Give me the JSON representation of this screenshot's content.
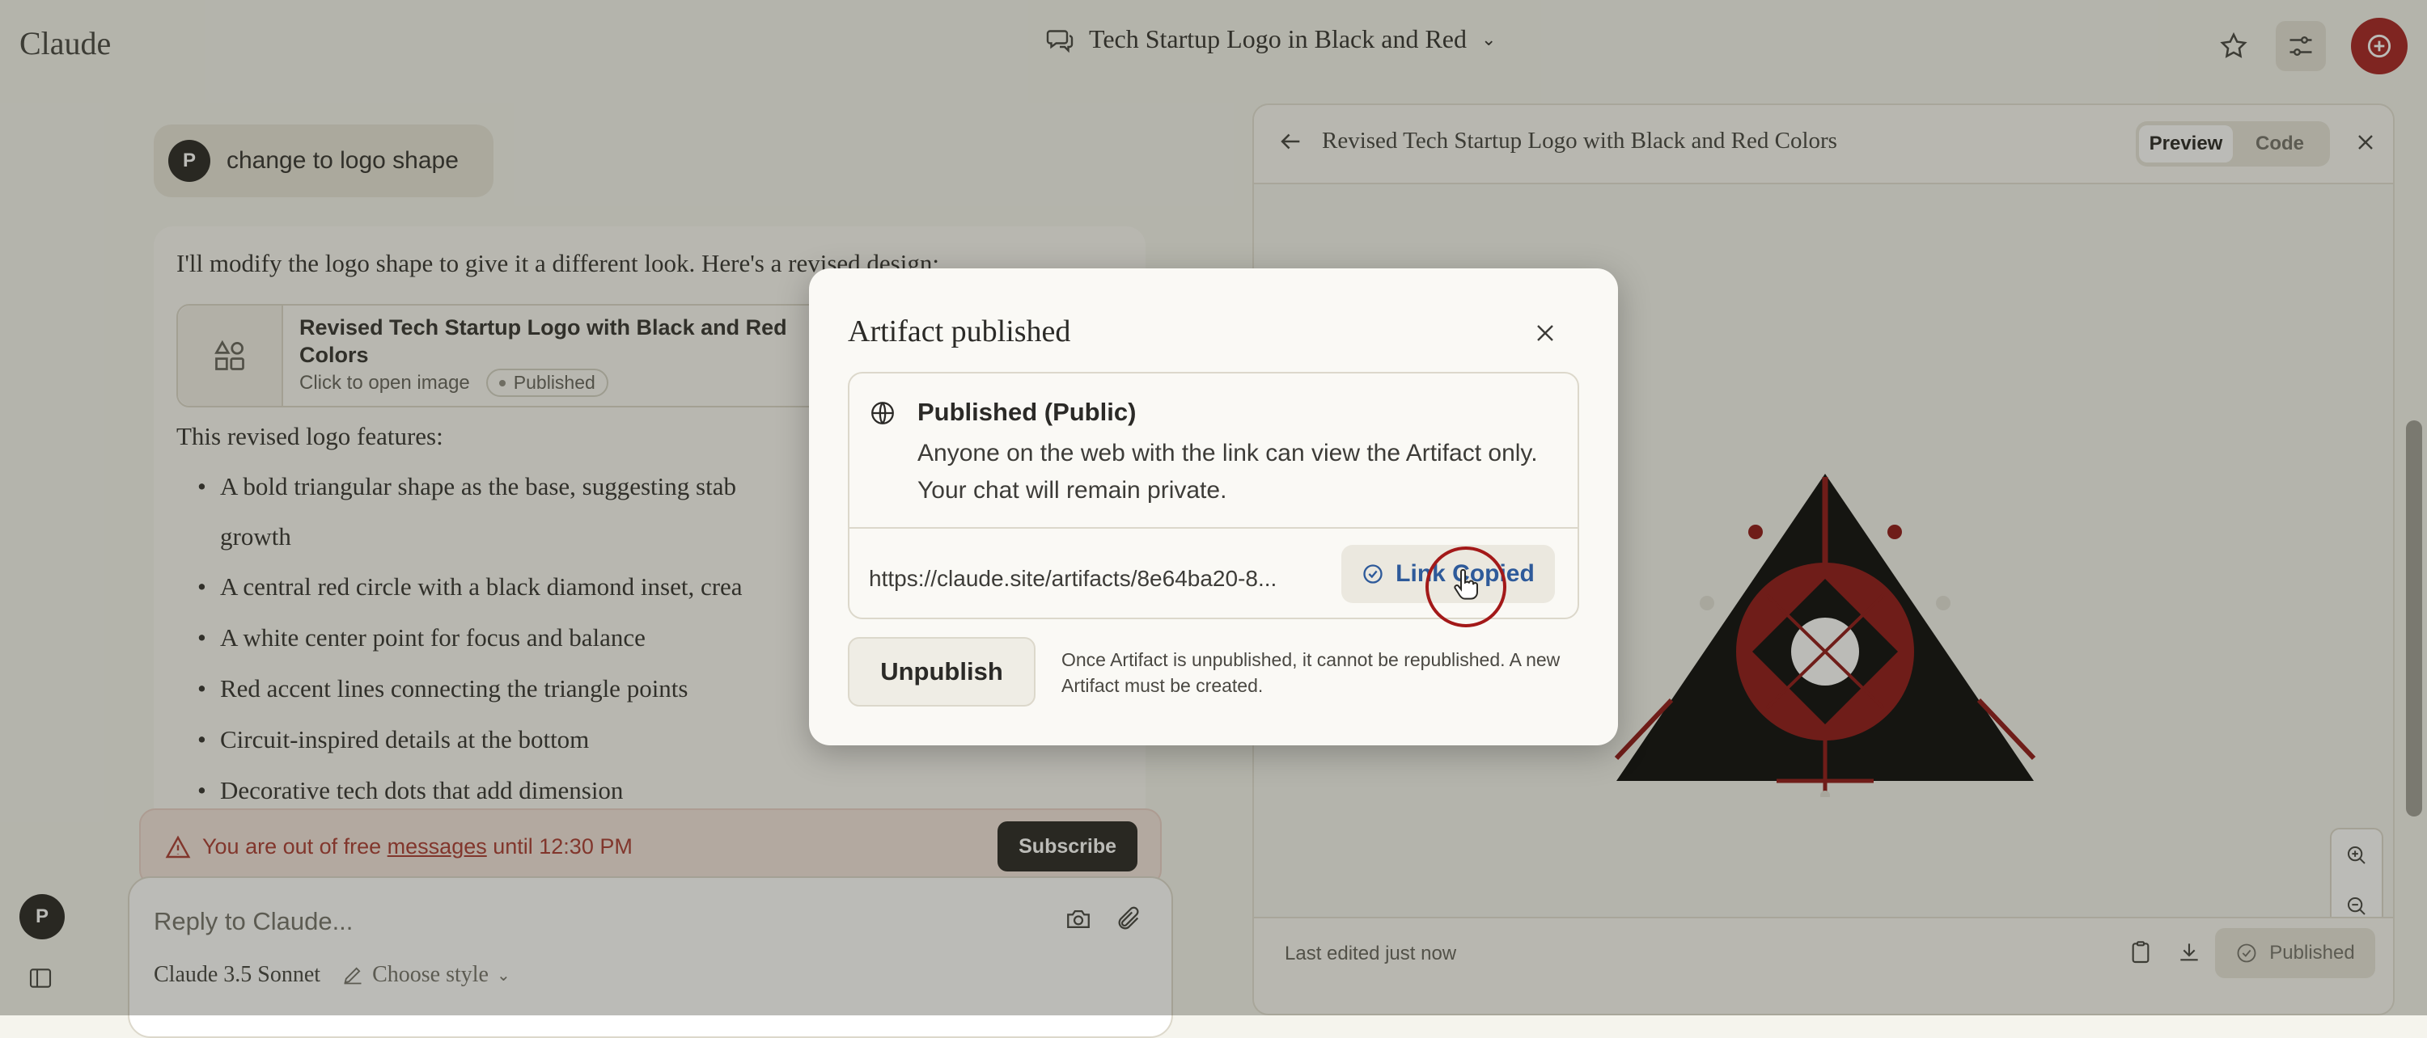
{
  "app": {
    "title": "Claude"
  },
  "header": {
    "conversation_title": "Tech Startup Logo in Black and Red"
  },
  "chat": {
    "user_initial": "P",
    "user_message": "change to logo shape",
    "assistant_intro": "I'll modify the logo shape to give it a different look. Here's a revised design:",
    "artifact": {
      "title": "Revised Tech Startup Logo with Black and Red Colors",
      "subtitle": "Click to open image",
      "badge": "Published"
    },
    "features_title": "This revised logo features:",
    "features": [
      "A bold triangular shape as the base, suggesting stab",
      "growth",
      "A central red circle with a black diamond inset, crea",
      "A white center point for focus and balance",
      "Red accent lines connecting the triangle points",
      "Circuit-inspired details at the bottom",
      "Decorative tech dots that add dimension"
    ]
  },
  "limit_banner": {
    "prefix": "You are out of free ",
    "link": "messages",
    "suffix": " until 12:30 PM",
    "button": "Subscribe"
  },
  "composer": {
    "placeholder": "Reply to Claude...",
    "model": "Claude 3.5 Sonnet",
    "style": "Choose style"
  },
  "sidebar": {
    "user_initial": "P"
  },
  "preview_panel": {
    "title": "Revised Tech Startup Logo with Black and Red Colors",
    "tabs": [
      "Preview",
      "Code"
    ],
    "active_tab": "Preview",
    "footer_status": "Last edited just now",
    "published_label": "Published"
  },
  "modal": {
    "title": "Artifact published",
    "visibility_heading": "Published (Public)",
    "visibility_desc": "Anyone on the web with the link can view the Artifact only. Your chat will remain private.",
    "url": "https://claude.site/artifacts/8e64ba20-8...",
    "copy_state": "Link Copied",
    "unpublish_button": "Unpublish",
    "unpublish_note": "Once Artifact is unpublished, it cannot be republished. A new Artifact must be created."
  },
  "colors": {
    "accent": "#a31919",
    "background": "#f5f4ed",
    "link_blue": "#2e5a9a",
    "warning_red": "#a7332a"
  }
}
